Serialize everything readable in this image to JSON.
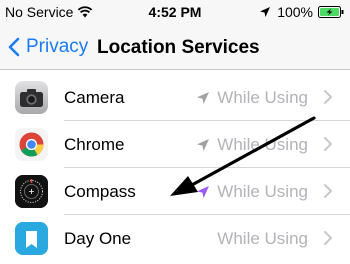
{
  "status_bar": {
    "carrier": "No Service",
    "time": "4:52 PM",
    "battery_percent": "100%",
    "icons": [
      "wifi-icon",
      "location-arrow-icon",
      "battery-icon",
      "charging-bolt-icon"
    ]
  },
  "nav": {
    "back_label": "Privacy",
    "title": "Location Services"
  },
  "apps": [
    {
      "name": "Camera",
      "status": "While Using",
      "icon": "camera-icon",
      "arrow_color": "#a0a0a5"
    },
    {
      "name": "Chrome",
      "status": "While Using",
      "icon": "chrome-icon",
      "arrow_color": "#a0a0a5"
    },
    {
      "name": "Compass",
      "status": "While Using",
      "icon": "compass-icon",
      "arrow_color": "#9b59f5"
    },
    {
      "name": "Day One",
      "status": "While Using",
      "icon": "day-one-icon",
      "arrow_color": null
    }
  ],
  "colors": {
    "accent": "#1a7cf5",
    "recent_location_arrow": "#9b59f5",
    "battery_fill": "#4cd964",
    "status_text": "#b3b3b8"
  }
}
